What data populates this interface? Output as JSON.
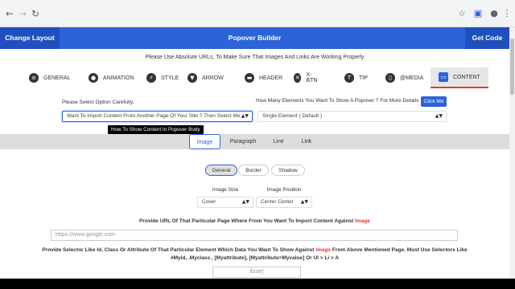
{
  "header": {
    "change_layout": "Change Layout",
    "title": "Popover Builder",
    "get_code": "Get Code"
  },
  "notice": "Please Use Absolute URLs, To Make Sure That Images And Links Are Working Properly",
  "tabs": [
    {
      "label": "GENERAL",
      "icon": "list-icon",
      "glyph": "≡"
    },
    {
      "label": "ANIMATION",
      "icon": "location-icon",
      "glyph": "●"
    },
    {
      "label": "STYLE",
      "icon": "bolt-icon",
      "glyph": "⚡"
    },
    {
      "label": "ARROW",
      "icon": "caret-down-icon",
      "glyph": "▼"
    },
    {
      "label": "HEADER",
      "icon": "car-icon",
      "glyph": "▬"
    },
    {
      "label": "X-BTN",
      "icon": "close-icon",
      "glyph": "✕"
    },
    {
      "label": "TIP",
      "icon": "tip-icon",
      "glyph": "T"
    },
    {
      "label": "@MEDIA",
      "icon": "mobile-icon",
      "glyph": "▯"
    },
    {
      "label": "CONTENT",
      "icon": "window-icon",
      "glyph": "▭",
      "active": true
    }
  ],
  "content": {
    "select_label": "Please Select Option Carefully.",
    "select_value": "Want To Import Content From Another Page Of Your Site ? Then Select Me",
    "elements_label": "How Many Elements You Want To Show A Popover ? For More Details",
    "click_me": "Click Me",
    "elements_value": "Single Element ( Default )",
    "tooltip": "How To Show Content In Popover Body"
  },
  "subtabs": [
    "Image",
    "Paragraph",
    "Line",
    "Link"
  ],
  "pills": [
    "General",
    "Border",
    "Shadow"
  ],
  "image_size": {
    "label": "Image Size",
    "value": "Cover"
  },
  "image_position": {
    "label": "Image Position",
    "value": "Center Center"
  },
  "url_prompt": {
    "before": "Provide URL Of That Particular Page Where From You Want To Import Content Against ",
    "highlight": "Image"
  },
  "url_placeholder": "https://www.google.com",
  "selector_prompt": {
    "before": "Provide Selector Like Id, Class Or Attribute Of That Particular Element Which Data You Want To Show Against ",
    "highlight": "Image",
    "after": " From Above Mentioned Page. Must Use Selectors Like"
  },
  "selector_examples": "#Myid, .Myclass , [Myattribute], [Myattribute=Myvalue] Or Ul > Li > A",
  "partial_field": "ibute]",
  "colors": {
    "primary": "#2b63d9",
    "accent": "#e53935"
  }
}
